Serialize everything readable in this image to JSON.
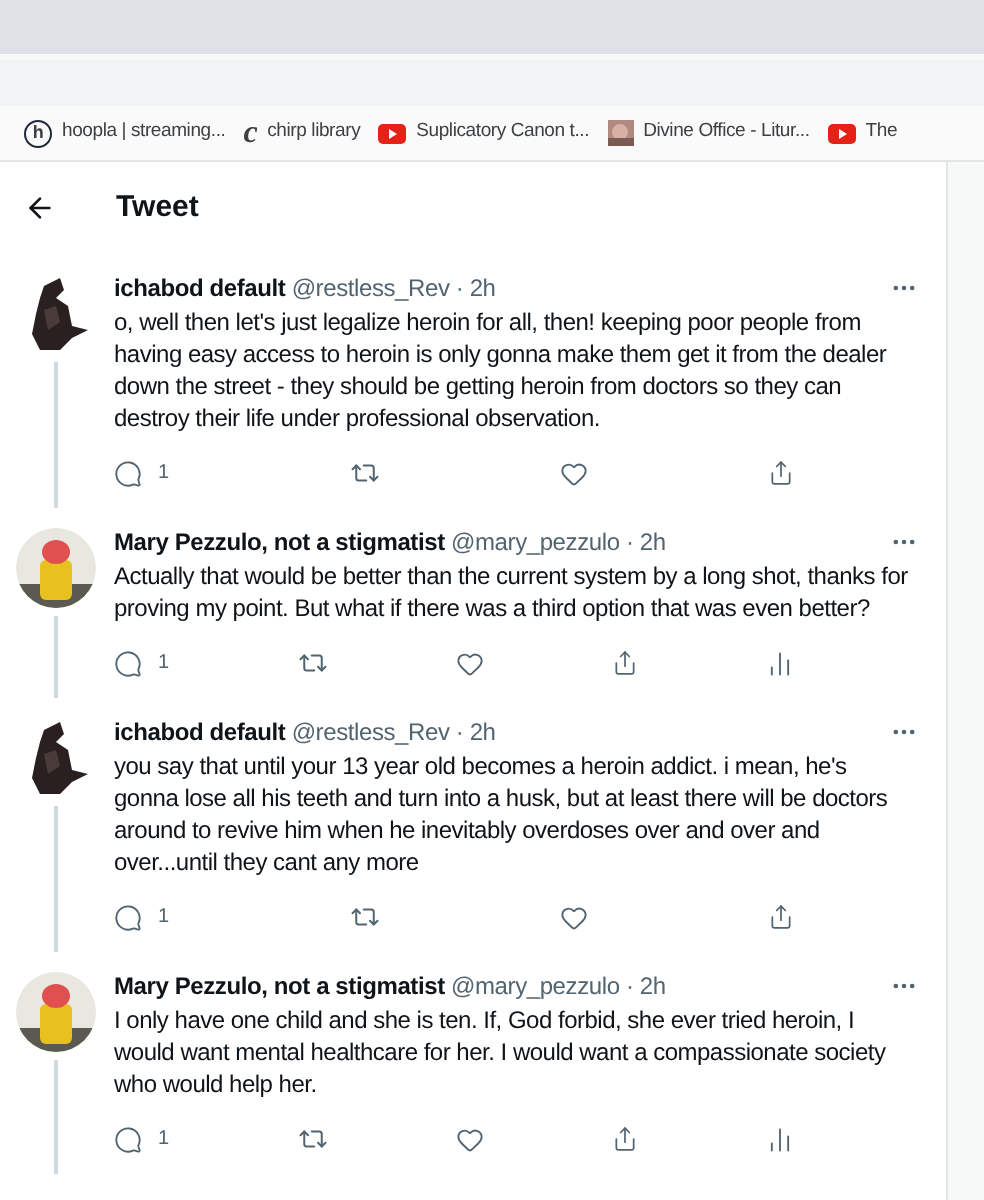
{
  "bookmarks": [
    {
      "kind": "glyph",
      "icon_text": "h",
      "label": "hoopla | streaming..."
    },
    {
      "kind": "serif",
      "icon_text": "c",
      "label": "chirp library"
    },
    {
      "kind": "video",
      "label": "Suplicatory Canon t..."
    },
    {
      "kind": "thumb",
      "label": "Divine Office - Litur..."
    },
    {
      "kind": "video",
      "label": "The"
    }
  ],
  "header": {
    "title": "Tweet"
  },
  "tweets": [
    {
      "avatar": {
        "kind": "dark"
      },
      "name": "ichabod default",
      "handle": "@restless_Rev",
      "time": "· 2h",
      "text": "o, well then let's just legalize heroin for all, then! keeping poor people from having easy access to heroin is only gonna make them get it from the dealer down the street - they should be getting heroin from doctors so they can destroy their life under professional observation.",
      "actions": [
        {
          "kind": "reply",
          "count": "1"
        },
        {
          "kind": "retweet"
        },
        {
          "kind": "like"
        },
        {
          "kind": "share"
        }
      ]
    },
    {
      "avatar": {
        "kind": "toy"
      },
      "name": "Mary Pezzulo, not a stigmatist",
      "handle": "@mary_pezzulo",
      "time": "· 2h",
      "text": "Actually that would be better than the current system by a long shot, thanks for proving my point. But what if there was a third option that was even better?",
      "actions": [
        {
          "kind": "reply",
          "count": "1"
        },
        {
          "kind": "retweet"
        },
        {
          "kind": "like"
        },
        {
          "kind": "share"
        },
        {
          "kind": "analytics"
        }
      ]
    },
    {
      "avatar": {
        "kind": "dark"
      },
      "name": "ichabod default",
      "handle": "@restless_Rev",
      "time": "· 2h",
      "text": "you say that until your 13 year old becomes a heroin addict. i mean, he's gonna lose all his teeth and turn into a husk, but at least there will be doctors around to revive him when he inevitably overdoses over and over and over...until they cant any more",
      "actions": [
        {
          "kind": "reply",
          "count": "1"
        },
        {
          "kind": "retweet"
        },
        {
          "kind": "like"
        },
        {
          "kind": "share"
        }
      ]
    },
    {
      "avatar": {
        "kind": "toy"
      },
      "name": "Mary Pezzulo, not a stigmatist",
      "handle": "@mary_pezzulo",
      "time": "· 2h",
      "text": "I only have one child and she is ten. If, God forbid, she ever tried heroin, I would want mental healthcare for her. I would want a compassionate society who would help her.",
      "actions": [
        {
          "kind": "reply",
          "count": "1"
        },
        {
          "kind": "retweet"
        },
        {
          "kind": "like"
        },
        {
          "kind": "share"
        },
        {
          "kind": "analytics"
        }
      ]
    }
  ]
}
